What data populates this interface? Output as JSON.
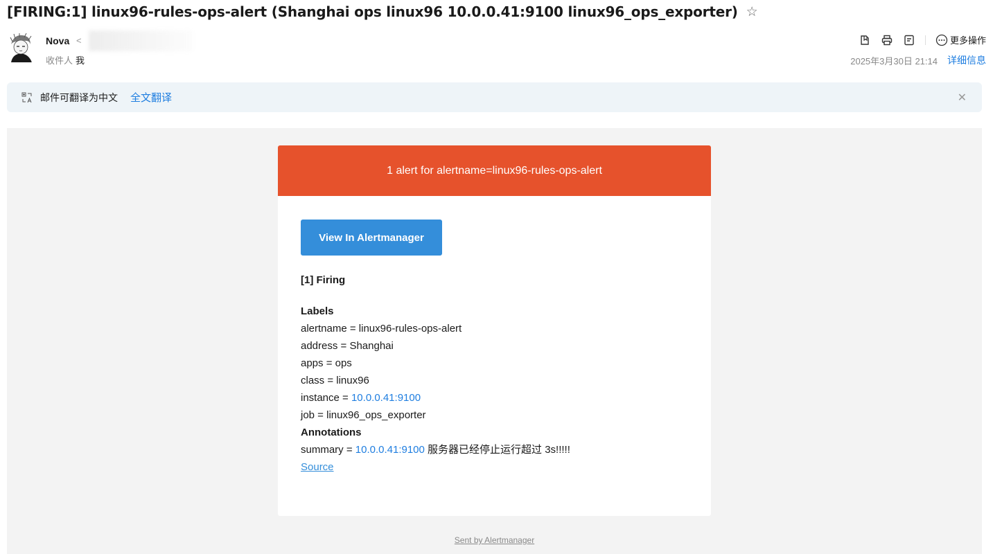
{
  "subject": "[FIRING:1] linux96-rules-ops-alert (Shanghai ops linux96 10.0.0.41:9100 linux96_ops_exporter)",
  "sender": {
    "name": "Nova",
    "email_prefix": "<",
    "recipient_label": "收件人",
    "recipient_name": "我"
  },
  "toolbar": {
    "more_actions": "更多操作",
    "icons": [
      "bookmark-icon",
      "print-icon",
      "note-icon",
      "more-icon"
    ]
  },
  "date": "2025年3月30日 21:14",
  "detail_link": "详细信息",
  "translate": {
    "text": "邮件可翻译为中文",
    "link": "全文翻译"
  },
  "alert": {
    "header": "1 alert for alertname=linux96-rules-ops-alert",
    "button": "View In Alertmanager",
    "firing": "[1] Firing",
    "labels_title": "Labels",
    "labels": {
      "alertname": "alertname = linux96-rules-ops-alert",
      "address": "address = Shanghai",
      "apps": "apps = ops",
      "class": "class = linux96",
      "instance_key": "instance = ",
      "instance_val": "10.0.0.41:9100",
      "job": "job = linux96_ops_exporter"
    },
    "annotations_title": "Annotations",
    "summary_key": "summary = ",
    "summary_ip": "10.0.0.41:9100",
    "summary_rest": " 服务器已经停止运行超过 3s!!!!!",
    "source": "Source"
  },
  "footer": "Sent by Alertmanager",
  "colors": {
    "alert_header": "#e6522c",
    "button": "#348eda",
    "link": "#1f7ee0"
  }
}
